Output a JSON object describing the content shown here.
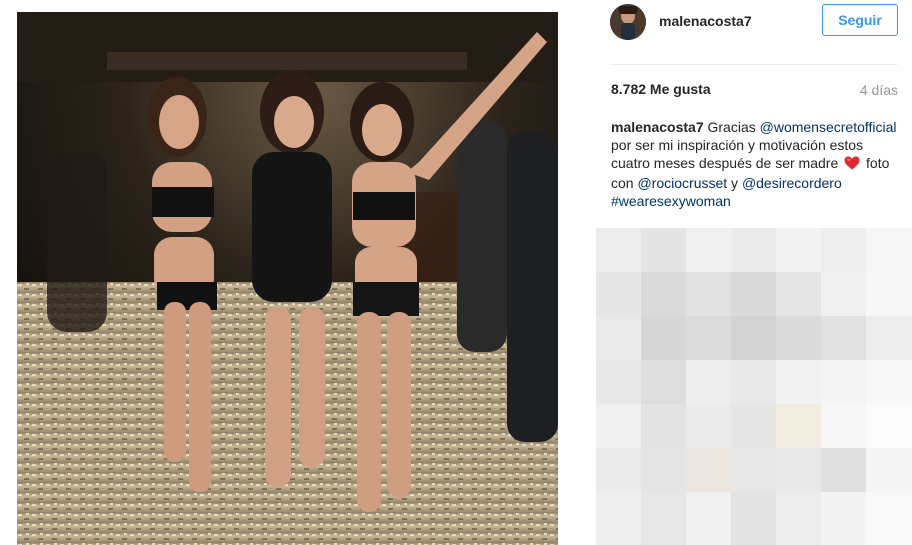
{
  "header": {
    "username": "malenacosta7",
    "follow_label": "Seguir"
  },
  "stats": {
    "likes": "8.782 Me gusta",
    "time_ago": "4 días"
  },
  "caption": {
    "author": "malenacosta7",
    "seg1": " Gracias ",
    "mention1": "@womensecretofficial",
    "seg2": " por ser mi inspiración y motivación estos cuatro meses después de ser madre ",
    "seg3": " foto con ",
    "mention2": "@rociocrusset",
    "seg4": " y ",
    "mention3": "@desirecordero",
    "seg5": " ",
    "hashtag": "#wearesexywoman"
  },
  "icons": {
    "heart": "red-heart-emoji"
  },
  "colors": {
    "follow_blue": "#3897f0",
    "link_blue": "#003569",
    "muted_gray": "#999999",
    "heart_red": "#e0262e"
  }
}
